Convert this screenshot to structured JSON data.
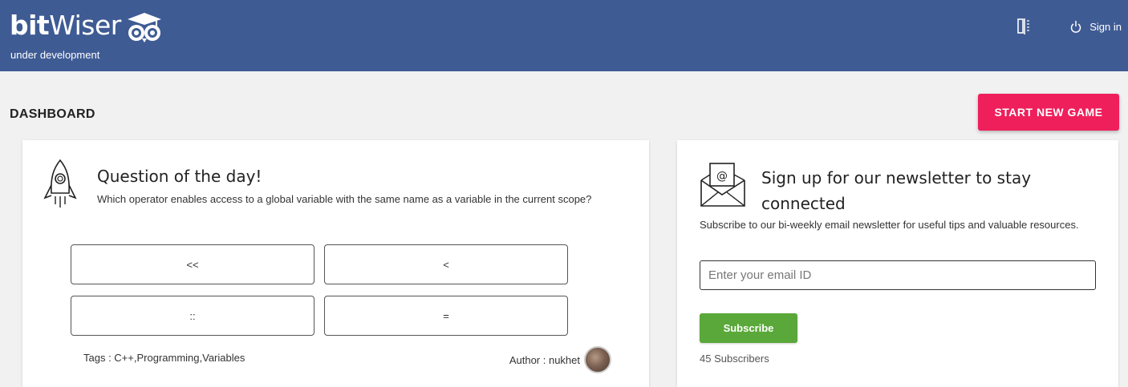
{
  "header": {
    "logo_bold": "bit",
    "logo_light": "Wiser",
    "tagline": "under development",
    "signin_label": "Sign in",
    "bg_color": "#3f5b94"
  },
  "dashboard": {
    "title": "DASHBOARD",
    "start_button": "START NEW GAME"
  },
  "question_card": {
    "title": "Question of the day!",
    "question": "Which operator enables access to a global variable with the same name as a variable in the current scope?",
    "options": [
      "<<",
      "<",
      "::",
      "="
    ],
    "tags": "Tags : C++,Programming,Variables",
    "author": "Author : nukhet",
    "icon": "rocket-icon"
  },
  "newsletter_card": {
    "title": "Sign up for our newsletter to stay connected",
    "description": "Subscribe to our bi-weekly email newsletter for useful tips and valuable resources.",
    "email_placeholder": "Enter your email ID",
    "subscribe_label": "Subscribe",
    "subscribers": "45 Subscribers",
    "icon": "envelope-icon"
  },
  "colors": {
    "accent_pink": "#ef1f5c",
    "subscribe_green": "#5aa839"
  }
}
